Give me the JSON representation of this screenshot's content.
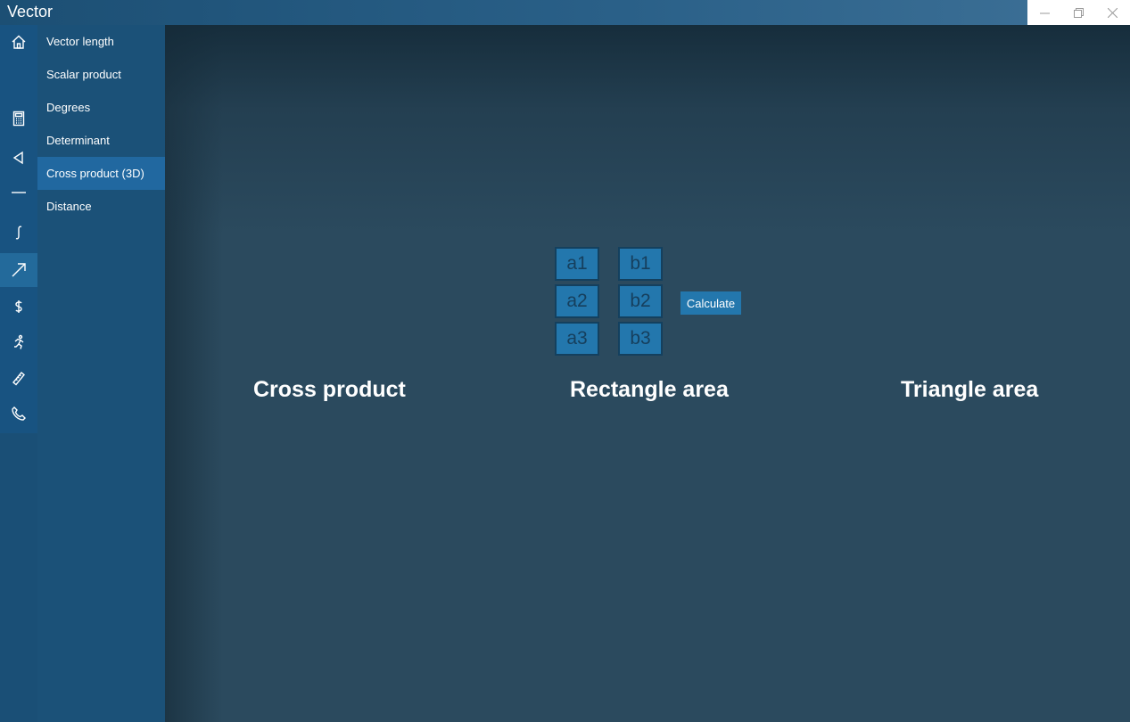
{
  "window": {
    "title": "Vector",
    "controls": [
      "minimize-icon",
      "restore-icon",
      "close-icon"
    ]
  },
  "rail": {
    "icons": [
      "home-icon",
      "calculator-icon",
      "triangle-icon",
      "line-icon",
      "integral-icon",
      "vector-arrow-icon",
      "dollar-icon",
      "running-person-icon",
      "ruler-icon",
      "phone-icon"
    ],
    "active": "vector-arrow-icon"
  },
  "menu": {
    "items": [
      {
        "label": "Vector length"
      },
      {
        "label": "Scalar product"
      },
      {
        "label": "Degrees"
      },
      {
        "label": "Determinant"
      },
      {
        "label": "Cross product (3D)"
      },
      {
        "label": "Distance"
      }
    ],
    "active_index": 4
  },
  "inputs": {
    "a1": "a1",
    "a2": "a2",
    "a3": "a3",
    "b1": "b1",
    "b2": "b2",
    "b3": "b3"
  },
  "calculate_label": "Calculate",
  "sections": {
    "cross_product": "Cross product",
    "rectangle_area": "Rectangle area",
    "triangle_area": "Triangle area"
  },
  "colors": {
    "accent": "#2377ad",
    "sidebar": "#1b5178",
    "background": "#2b4a5e"
  }
}
